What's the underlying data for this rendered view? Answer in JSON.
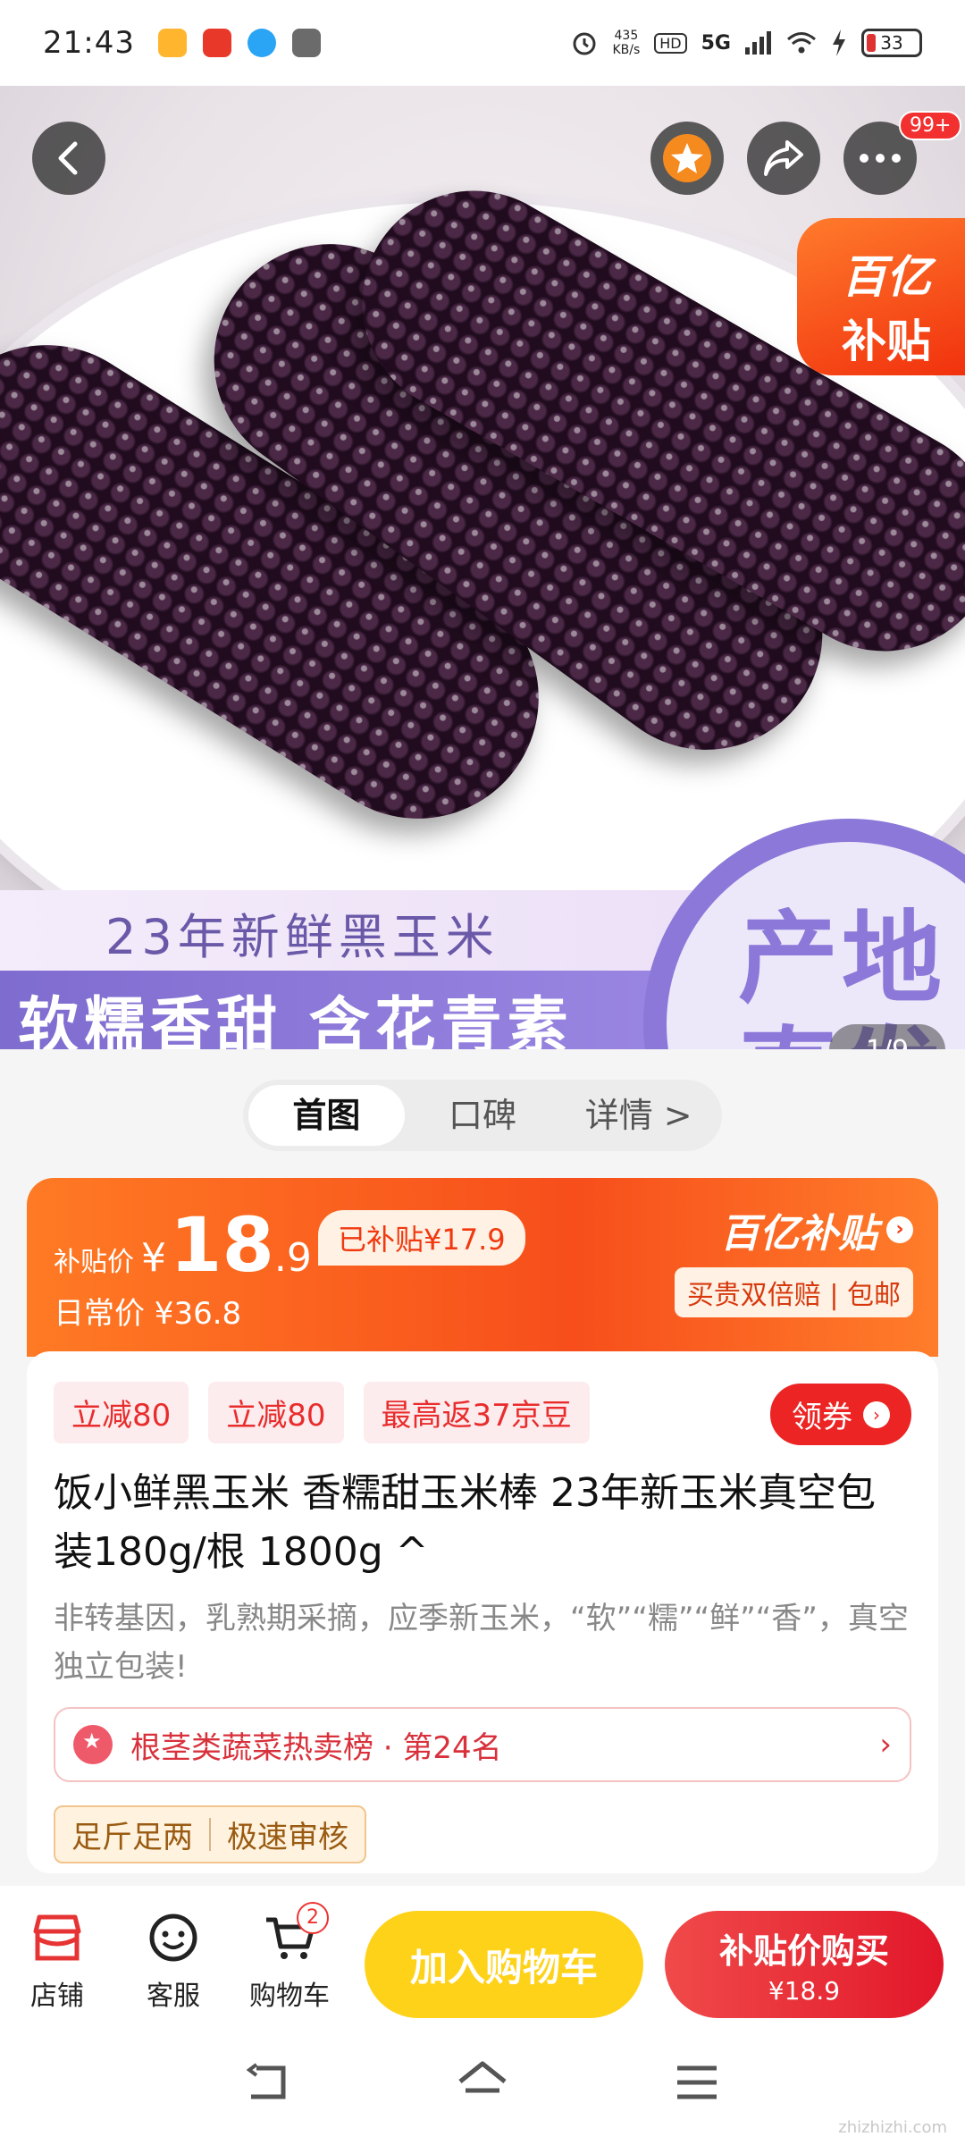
{
  "status_bar": {
    "time": "21:43",
    "net_speed_value": "435",
    "net_speed_unit": "KB/s",
    "hd": "HD",
    "network": "5G",
    "battery": "33"
  },
  "hero": {
    "banner_subtitle": "23年新鲜黑玉米",
    "banner_title": "软糯香甜 含花青素",
    "origin_line1": "产地",
    "origin_line2": "直发",
    "subsidy_tag_line1": "百亿",
    "subsidy_tag_line2": "补贴",
    "pager": "1/9",
    "notification_count": "99+"
  },
  "tabs": [
    {
      "label": "首图"
    },
    {
      "label": "口碑"
    },
    {
      "label": "详情 >"
    }
  ],
  "price": {
    "label": "补贴价",
    "currency": "¥",
    "integer": "18",
    "decimal": ".9",
    "subsidized": "已补贴¥17.9",
    "daily_price": "日常价 ¥36.8",
    "brand": "百亿补贴",
    "guarantee": "买贵双倍赔 | 包邮"
  },
  "card": {
    "coupons": [
      "立减80",
      "立减80",
      "最高返37京豆"
    ],
    "get_coupon": "领券",
    "title": "饭小鲜黑玉米 香糯甜玉米棒 23年新玉米真空包装180g/根 1800g ^",
    "description": "非转基因，乳熟期采摘，应季新玉米，“软”“糯”“鲜”“香”，真空独立包装!",
    "rank": "根茎类蔬菜热卖榜 · 第24名",
    "tags": [
      "足斤足两",
      "极速审核"
    ]
  },
  "action_bar": {
    "store": "店铺",
    "service": "客服",
    "cart": "购物车",
    "cart_count": "2",
    "add_to_cart": "加入购物车",
    "buy_label": "补贴价购买",
    "buy_price": "¥18.9"
  },
  "watermark": "zhizhizhi.com",
  "colors": {
    "accent": "#f2380f",
    "buy_button": "#e2172a",
    "cart_button": "#ffd21a"
  }
}
